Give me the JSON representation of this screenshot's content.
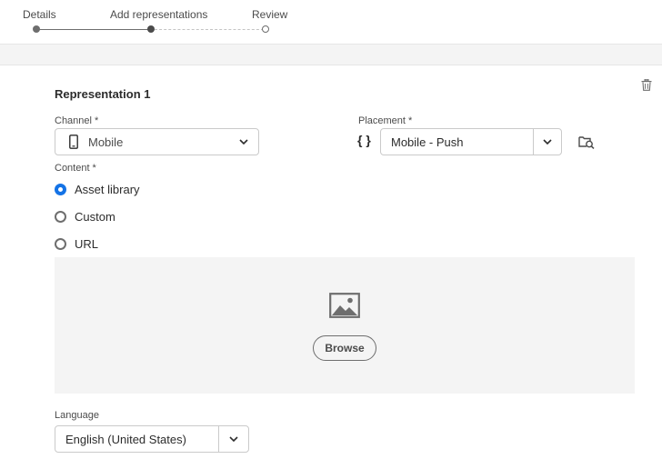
{
  "stepper": {
    "steps": [
      {
        "label": "Details",
        "state": "done"
      },
      {
        "label": "Add representations",
        "state": "current"
      },
      {
        "label": "Review",
        "state": "todo"
      }
    ]
  },
  "representation": {
    "title": "Representation 1",
    "delete_icon": "trash-icon"
  },
  "channel": {
    "label": "Channel",
    "required_mark": "*",
    "value": "Mobile",
    "icon": "mobile-phone-icon"
  },
  "placement": {
    "label": "Placement",
    "required_mark": "*",
    "value": "Mobile - Push",
    "prefix_glyph": "{ }",
    "browse_icon": "folder-search-icon"
  },
  "content": {
    "label": "Content",
    "required_mark": "*",
    "options": [
      {
        "label": "Asset library",
        "checked": true
      },
      {
        "label": "Custom",
        "checked": false
      },
      {
        "label": "URL",
        "checked": false
      }
    ]
  },
  "asset": {
    "icon": "image-icon",
    "browse_label": "Browse"
  },
  "language": {
    "label": "Language",
    "value": "English (United States)"
  },
  "colors": {
    "accent": "#1473e6",
    "band": "#f4f4f4",
    "border": "#cacaca"
  }
}
